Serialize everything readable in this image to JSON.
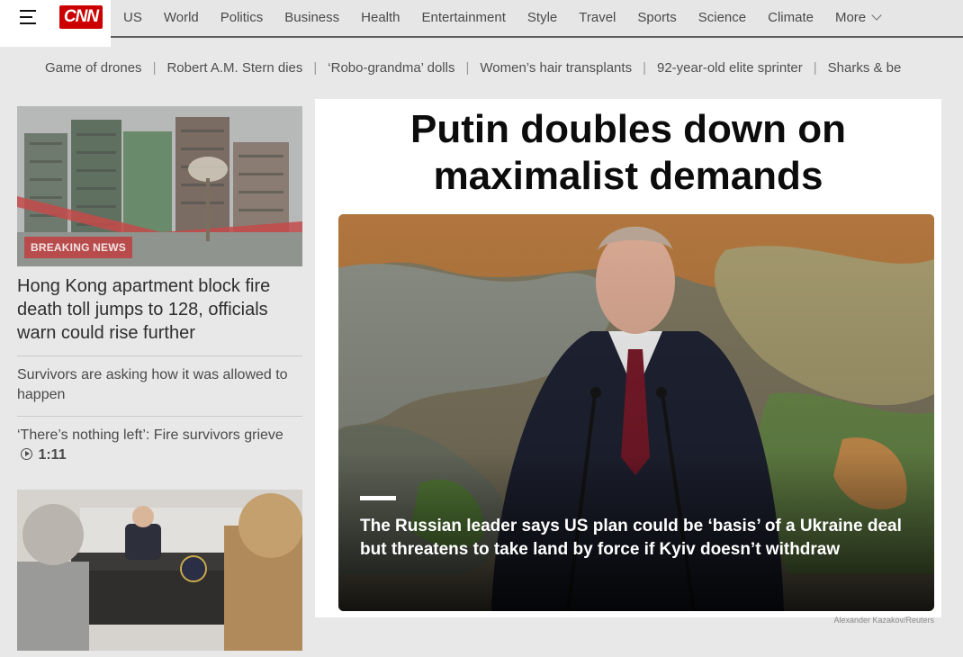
{
  "header": {
    "logo_text": "CNN",
    "nav": [
      "US",
      "World",
      "Politics",
      "Business",
      "Health",
      "Entertainment",
      "Style",
      "Travel",
      "Sports",
      "Science",
      "Climate"
    ],
    "more_label": "More"
  },
  "trending": [
    "Game of drones",
    "Robert A.M. Stern dies",
    "‘Robo-grandma’ dolls",
    "Women’s hair transplants",
    "92-year-old elite sprinter",
    "Sharks & be"
  ],
  "left": {
    "badge": "BREAKING NEWS",
    "headline": "Hong Kong apartment block fire death toll jumps to 128, officials warn could rise further",
    "sub1": "Survivors are asking how it was allowed to happen",
    "sub2": "‘There’s nothing left’: Fire survivors grieve",
    "sub2_duration": "1:11"
  },
  "lead": {
    "title": "Putin doubles down on maximalist demands",
    "caption": "The Russian leader says US plan could be ‘basis’ of a Ukraine deal but threatens to take land by force if Kyiv doesn’t withdraw",
    "credit": "Alexander Kazakov/Reuters"
  },
  "colors": {
    "brand": "#cc0000",
    "badge": "#b84c4c",
    "background": "#e8e8e8"
  }
}
